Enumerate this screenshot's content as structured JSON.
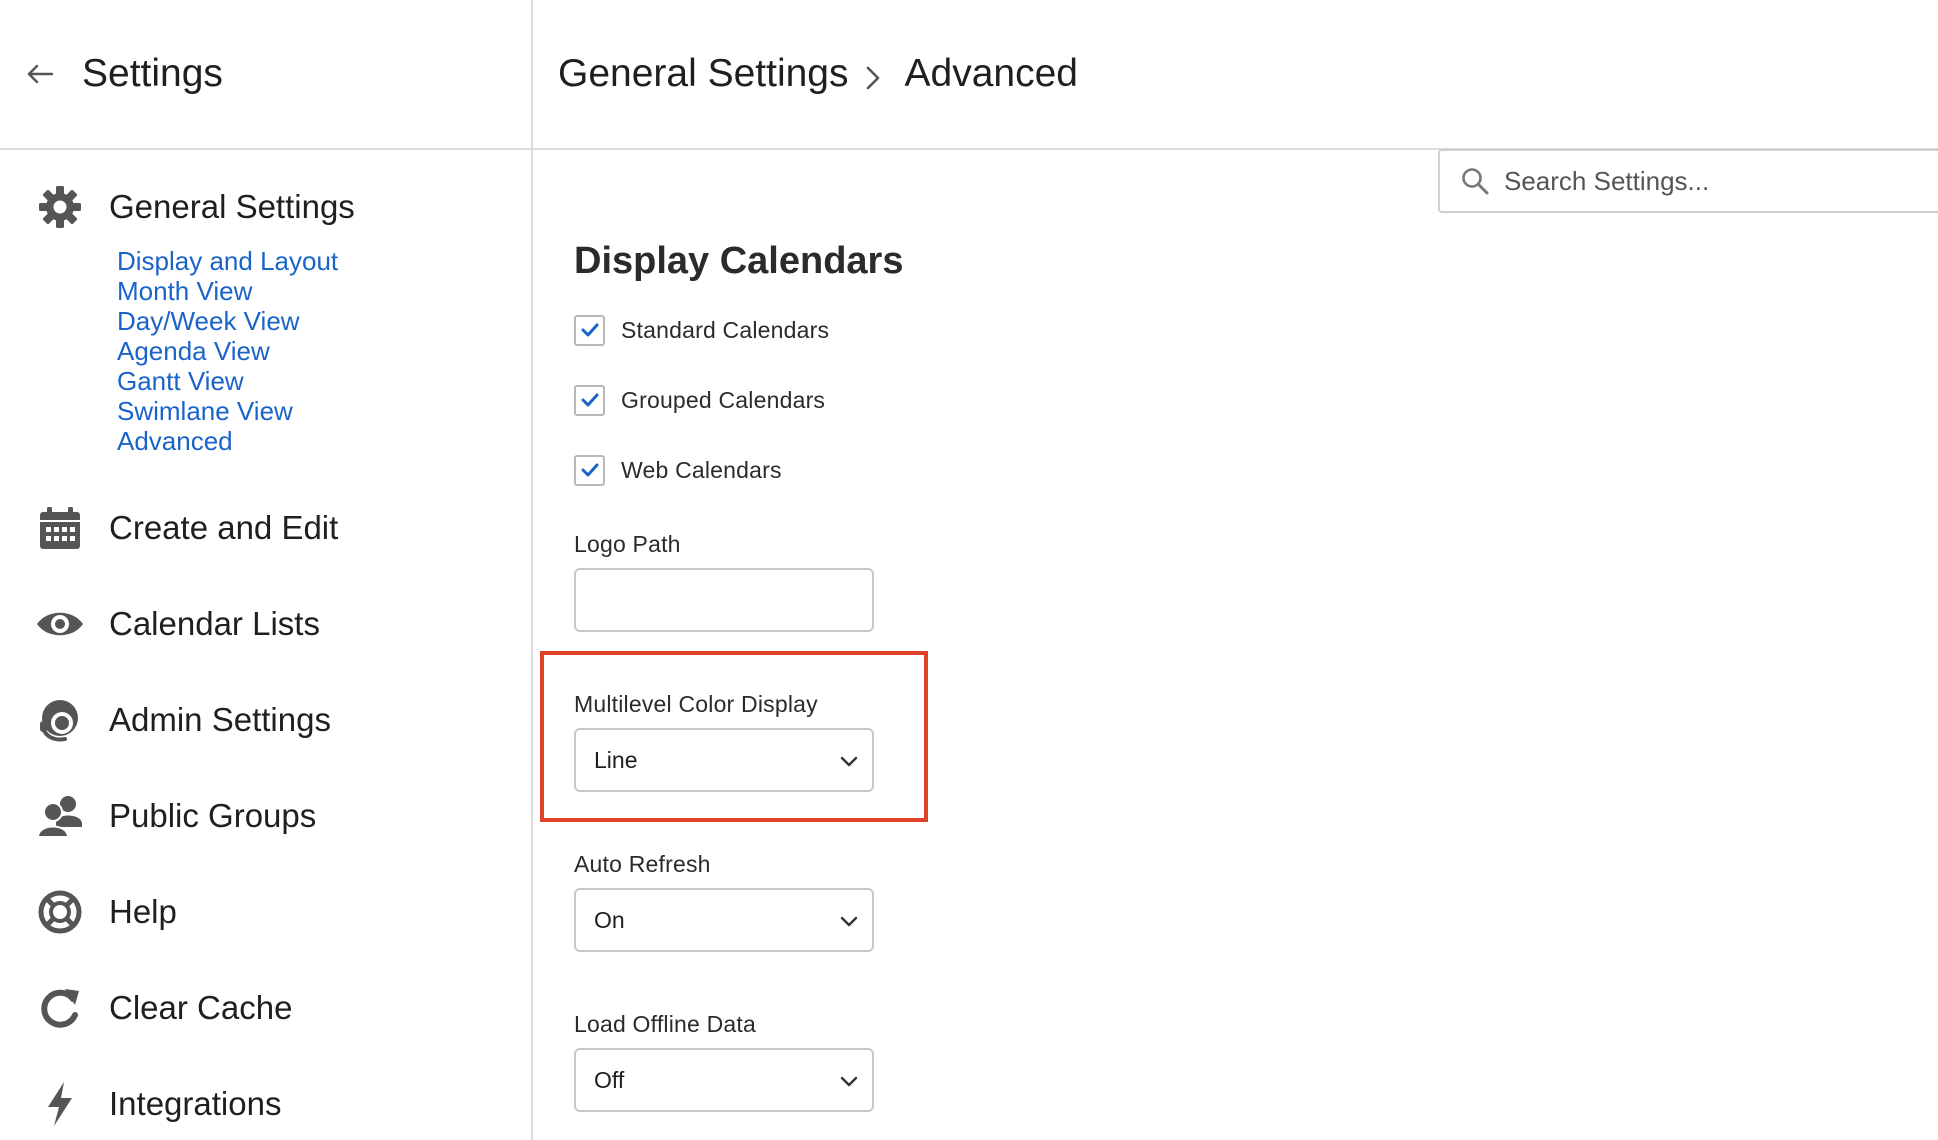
{
  "sidebar": {
    "title": "Settings",
    "nav": [
      {
        "label": "General Settings",
        "icon": "gear-icon"
      },
      {
        "label": "Create and Edit",
        "icon": "calendar-icon"
      },
      {
        "label": "Calendar Lists",
        "icon": "eye-icon"
      },
      {
        "label": "Admin Settings",
        "icon": "admin-headset-icon"
      },
      {
        "label": "Public Groups",
        "icon": "group-users-icon"
      },
      {
        "label": "Help",
        "icon": "lifebuoy-icon"
      },
      {
        "label": "Clear Cache",
        "icon": "refresh-icon"
      },
      {
        "label": "Integrations",
        "icon": "lightning-icon"
      }
    ],
    "general_subitems": [
      "Display and Layout",
      "Month View",
      "Day/Week View",
      "Agenda View",
      "Gantt View",
      "Swimlane View",
      "Advanced"
    ]
  },
  "header": {
    "breadcrumb": [
      "General Settings",
      "Advanced"
    ]
  },
  "search": {
    "placeholder": "Search Settings..."
  },
  "main": {
    "section_title": "Display Calendars",
    "checkboxes": [
      {
        "label": "Standard Calendars",
        "checked": true
      },
      {
        "label": "Grouped Calendars",
        "checked": true
      },
      {
        "label": "Web Calendars",
        "checked": true
      }
    ],
    "logo_path": {
      "label": "Logo Path",
      "value": ""
    },
    "multilevel_color": {
      "label": "Multilevel Color Display",
      "value": "Line"
    },
    "auto_refresh": {
      "label": "Auto Refresh",
      "value": "On"
    },
    "load_offline": {
      "label": "Load Offline Data",
      "value": "Off"
    }
  },
  "colors": {
    "link": "#1a64c8",
    "highlight": "#e0412b",
    "checkmark": "#1a64c8",
    "icon": "#555555"
  }
}
